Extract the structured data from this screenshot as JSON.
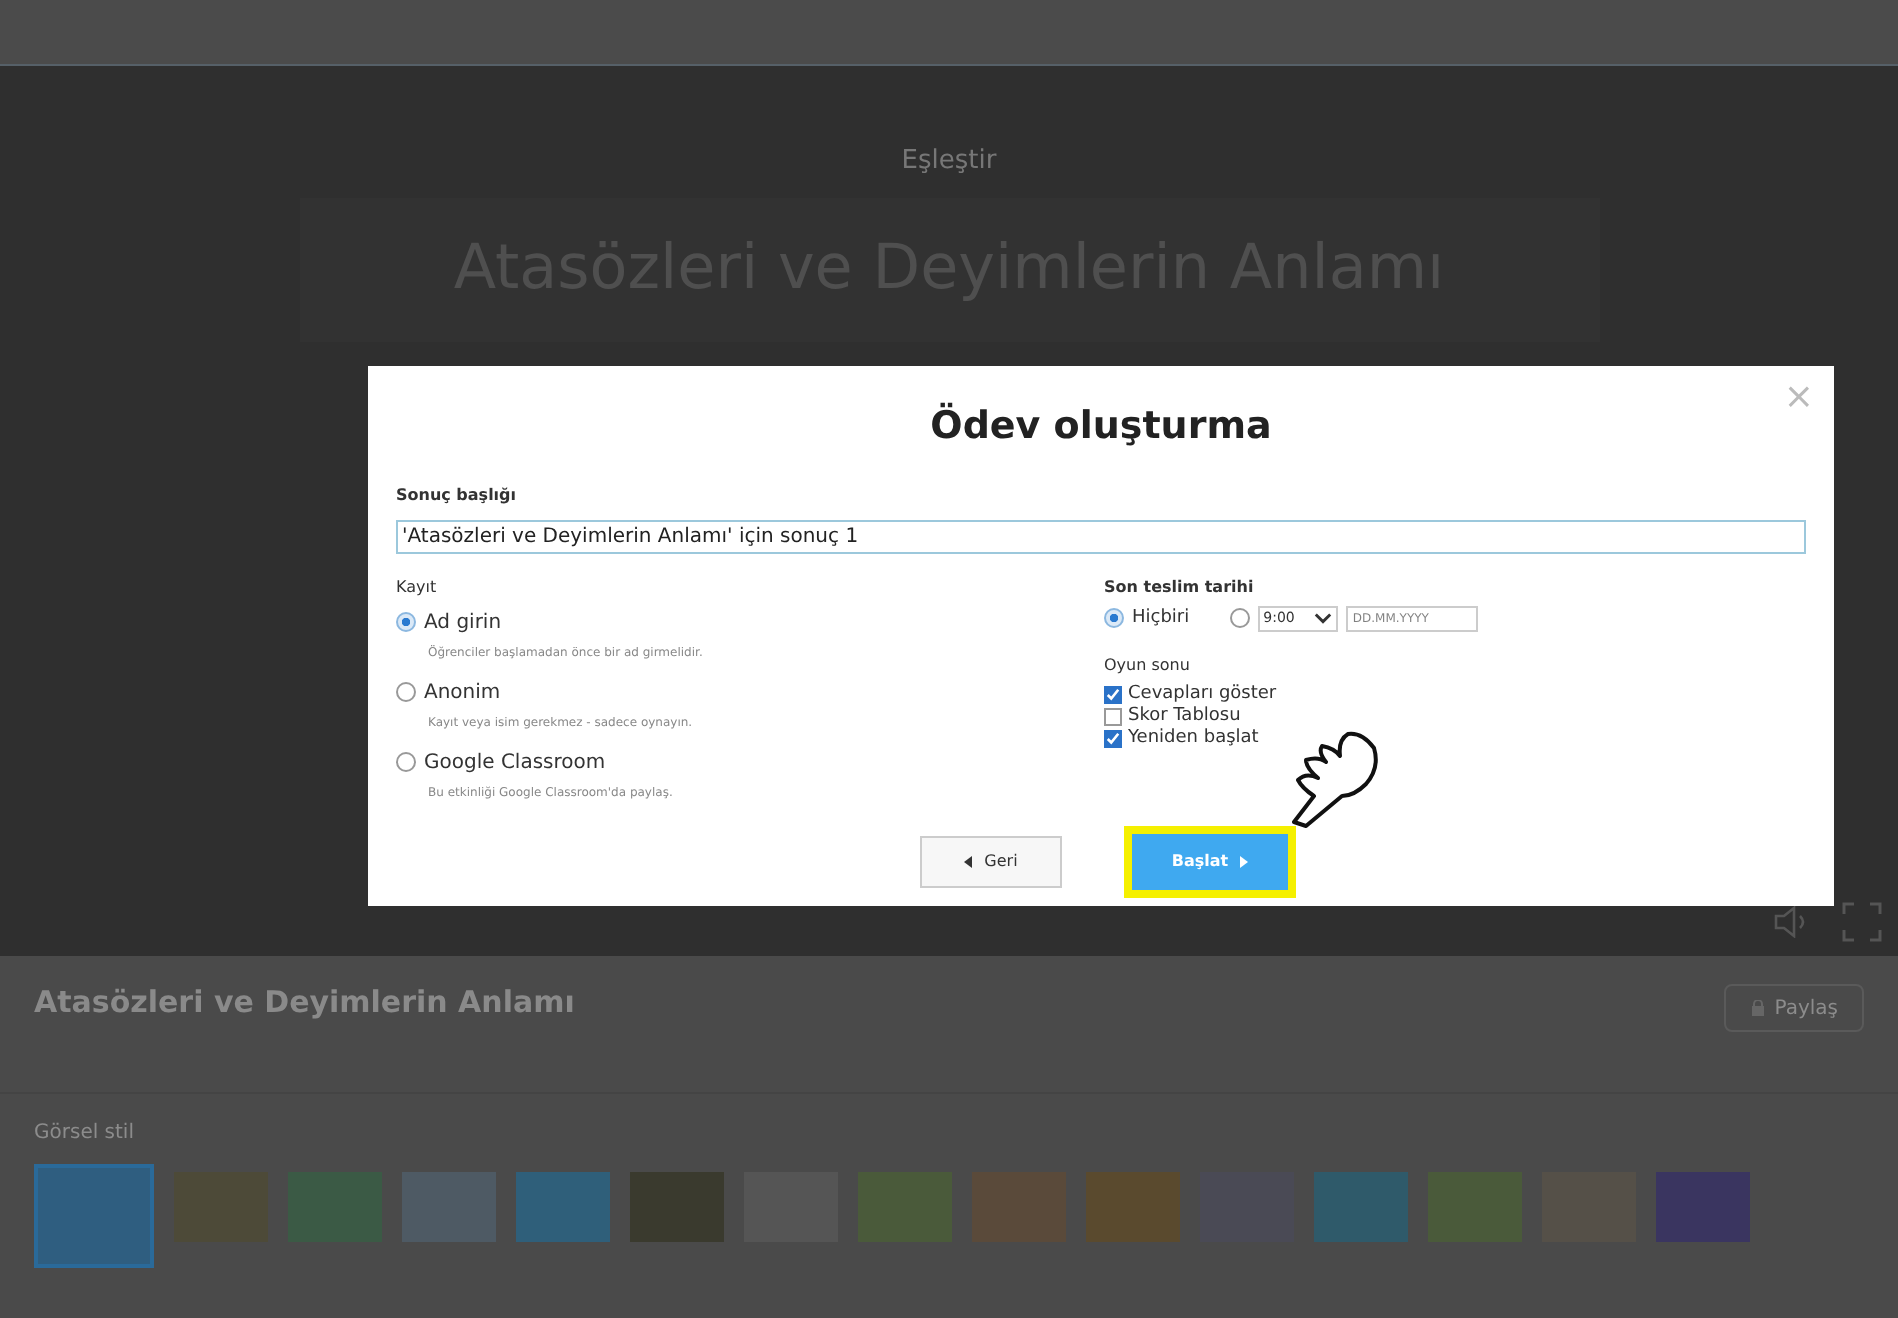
{
  "game": {
    "subtitle": "Eşleştir",
    "title": "Atasözleri ve Deyimlerin Anlamı"
  },
  "page": {
    "title": "Atasözleri ve Deyimlerin Anlamı",
    "share_button": "Paylaş",
    "styles_heading": "Görsel stil",
    "themes": [
      {
        "selected": true
      },
      {
        "selected": false
      },
      {
        "selected": false
      },
      {
        "selected": false
      },
      {
        "selected": false
      },
      {
        "selected": false
      },
      {
        "selected": false
      },
      {
        "selected": false
      },
      {
        "selected": false
      },
      {
        "selected": false
      },
      {
        "selected": false
      },
      {
        "selected": false
      },
      {
        "selected": false
      },
      {
        "selected": false
      },
      {
        "selected": false
      }
    ]
  },
  "dialog": {
    "close": "×",
    "title": "Ödev oluşturma",
    "result_title_label": "Sonuç başlığı",
    "result_title_value": "'Atasözleri ve Deyimlerin Anlamı' için sonuç 1",
    "registration": {
      "label": "Kayıt",
      "options": [
        {
          "label": "Ad girin",
          "hint": "Öğrenciler başlamadan önce bir ad girmelidir.",
          "selected": true
        },
        {
          "label": "Anonim",
          "hint": "Kayıt veya isim gerekmez - sadece oynayın.",
          "selected": false
        },
        {
          "label": "Google Classroom",
          "hint": "Bu etkinliği Google Classroom'da paylaş.",
          "selected": false
        }
      ]
    },
    "deadline": {
      "label": "Son teslim tarihi",
      "options": [
        {
          "kind": "none",
          "label": "Hiçbiri",
          "selected": true
        },
        {
          "kind": "datetime",
          "time": "9:00",
          "date_placeholder": "DD.MM.YYYY",
          "selected": false
        }
      ]
    },
    "game_end": {
      "label": "Oyun sonu",
      "options": [
        {
          "label": "Cevapları göster",
          "checked": true
        },
        {
          "label": "Skor Tablosu",
          "checked": false
        },
        {
          "label": "Yeniden başlat",
          "checked": true
        }
      ]
    },
    "back_button": "Geri",
    "start_button": "Başlat",
    "start_highlighted": true
  }
}
